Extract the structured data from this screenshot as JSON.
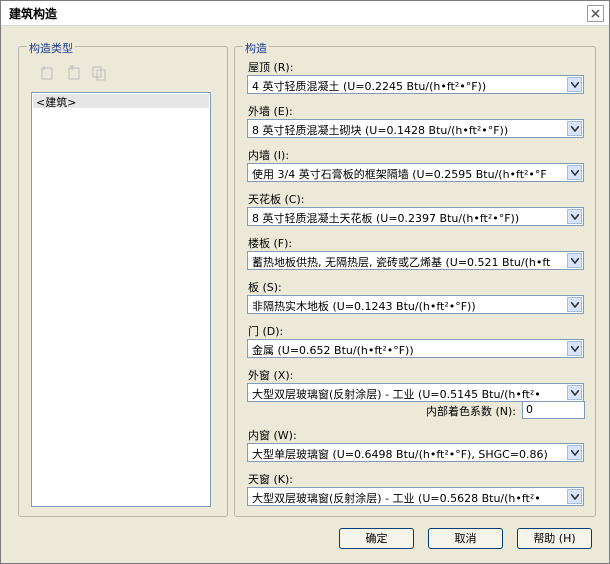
{
  "window": {
    "title": "建筑构造"
  },
  "left_group": {
    "legend": "构造类型",
    "list_items": [
      "<建筑>"
    ]
  },
  "right_group": {
    "legend": "构造",
    "fields": [
      {
        "label": "屋顶 (R):",
        "value": "4 英寸轻质混凝土 (U=0.2245 Btu/(h•ft²•°F))"
      },
      {
        "label": "外墙 (E):",
        "value": "8 英寸轻质混凝土砌块 (U=0.1428 Btu/(h•ft²•°F))"
      },
      {
        "label": "内墙 (I):",
        "value": "使用 3/4 英寸石膏板的框架隔墙 (U=0.2595 Btu/(h•ft²•°F"
      },
      {
        "label": "天花板 (C):",
        "value": "8 英寸轻质混凝土天花板 (U=0.2397 Btu/(h•ft²•°F))"
      },
      {
        "label": "楼板 (F):",
        "value": "蓄热地板供热, 无隔热层, 瓷砖或乙烯基 (U=0.521 Btu/(h•ft"
      },
      {
        "label": "板 (S):",
        "value": "非隔热实木地板 (U=0.1243 Btu/(h•ft²•°F))"
      },
      {
        "label": "门 (D):",
        "value": "金属 (U=0.652 Btu/(h•ft²•°F))"
      },
      {
        "label": "外窗 (X):",
        "value": "大型双层玻璃窗(反射涂层) - 工业 (U=0.5145 Btu/(h•ft²•"
      },
      {
        "label": "内窗 (W):",
        "value": "大型单层玻璃窗 (U=0.6498 Btu/(h•ft²•°F), SHGC=0.86)"
      },
      {
        "label": "天窗 (K):",
        "value": "大型双层玻璃窗(反射涂层) - 工业 (U=0.5628 Btu/(h•ft²•"
      }
    ],
    "shading": {
      "label": "内部着色系数 (N):",
      "value": "0"
    }
  },
  "buttons": {
    "ok": "确定",
    "cancel": "取消",
    "help": "帮助 (H)"
  }
}
